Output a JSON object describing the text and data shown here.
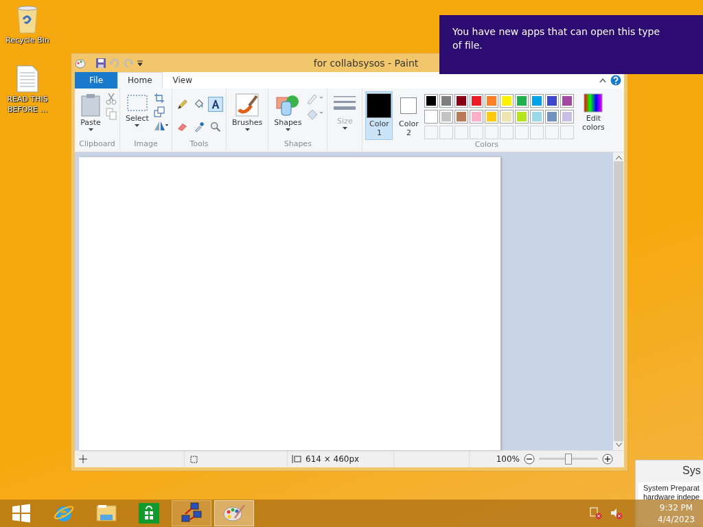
{
  "desktop_icons": [
    {
      "kind": "recycle-bin",
      "label": "Recycle Bin"
    },
    {
      "kind": "document",
      "label": "READ THIS BEFORE ..."
    }
  ],
  "notification": {
    "text": "You have new apps that can open this type of file."
  },
  "paint": {
    "title": "for collabsysos - Paint",
    "tabs": [
      {
        "kind": "file",
        "label": "File",
        "selected": false
      },
      {
        "kind": "tab",
        "label": "Home",
        "selected": true
      },
      {
        "kind": "tab",
        "label": "View",
        "selected": false
      }
    ],
    "clipboard": {
      "label": "Clipboard",
      "paste": "Paste"
    },
    "image": {
      "label": "Image",
      "select": "Select"
    },
    "tools": {
      "label": "Tools",
      "items": [
        {
          "kind": "pencil",
          "selected": false
        },
        {
          "kind": "fill",
          "selected": false
        },
        {
          "kind": "text",
          "selected": true
        },
        {
          "kind": "eraser",
          "selected": false
        },
        {
          "kind": "picker",
          "selected": false
        },
        {
          "kind": "magnifier",
          "selected": false
        }
      ]
    },
    "brushes": {
      "label": "Brushes"
    },
    "shapes": {
      "label": "Shapes",
      "button": "Shapes"
    },
    "size": {
      "label": "Size",
      "disabled": true
    },
    "colors": {
      "label": "Colors",
      "primary": {
        "label": "Color 1",
        "color": "#000000",
        "selected": true
      },
      "secondary": {
        "label": "Color 2",
        "color": "#ffffff",
        "selected": false
      },
      "palette": [
        {
          "color": "#000000"
        },
        {
          "color": "#7f7f7f"
        },
        {
          "color": "#880015"
        },
        {
          "color": "#ed1c24"
        },
        {
          "color": "#ff7f27"
        },
        {
          "color": "#fff200"
        },
        {
          "color": "#22b14c"
        },
        {
          "color": "#00a2e8"
        },
        {
          "color": "#3f48cc"
        },
        {
          "color": "#a349a4"
        },
        {
          "color": "#ffffff"
        },
        {
          "color": "#c3c3c3"
        },
        {
          "color": "#b97a57"
        },
        {
          "color": "#ffaec9"
        },
        {
          "color": "#ffc90e"
        },
        {
          "color": "#efe4b0"
        },
        {
          "color": "#b5e61d"
        },
        {
          "color": "#99d9ea"
        },
        {
          "color": "#7092be"
        },
        {
          "color": "#c8bfe7"
        },
        {
          "kind": "empty"
        },
        {
          "kind": "empty"
        },
        {
          "kind": "empty"
        },
        {
          "kind": "empty"
        },
        {
          "kind": "empty"
        },
        {
          "kind": "empty"
        },
        {
          "kind": "empty"
        },
        {
          "kind": "empty"
        },
        {
          "kind": "empty"
        },
        {
          "kind": "empty"
        }
      ],
      "edit": "Edit colors"
    },
    "status": {
      "dimensions": "614 × 460px",
      "zoom": "100%",
      "level": 0.5
    }
  },
  "background_window": {
    "title": "Sys",
    "lines": [
      "System Preparat",
      "hardware indepe"
    ]
  },
  "taskbar": {
    "buttons": [
      {
        "kind": "start",
        "running": false,
        "selected": false
      },
      {
        "kind": "browser",
        "running": false,
        "selected": false
      },
      {
        "kind": "explorer",
        "running": false,
        "selected": false
      },
      {
        "kind": "store",
        "running": false,
        "selected": false
      },
      {
        "kind": "network",
        "running": true,
        "selected": false
      },
      {
        "kind": "paint",
        "running": true,
        "selected": true
      }
    ],
    "time": "9:32 PM",
    "date": "4/4/2023"
  }
}
